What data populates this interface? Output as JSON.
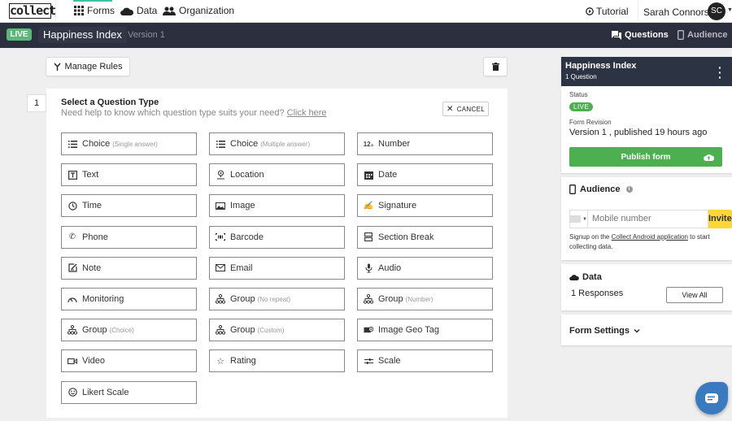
{
  "topnav": {
    "logo": "collect",
    "items": [
      {
        "label": "Forms",
        "icon": "grid-icon"
      },
      {
        "label": "Data",
        "icon": "cloud-icon"
      },
      {
        "label": "Organization",
        "icon": "people-icon"
      }
    ],
    "tutorial": "Tutorial",
    "user_name": "Sarah Connors",
    "user_initials": "SC"
  },
  "formbar": {
    "status": "LIVE",
    "title": "Happiness Index",
    "version": "Version 1",
    "tabs": [
      {
        "label": "Questions",
        "active": true
      },
      {
        "label": "Audience",
        "active": false
      }
    ]
  },
  "toolbar": {
    "manage_rules": "Manage Rules"
  },
  "question": {
    "number": "1",
    "title": "Select a Question Type",
    "help_text": "Need help to know which question type suits your need?",
    "help_link": "Click here",
    "cancel": "CANCEL",
    "types": [
      {
        "label": "Choice",
        "sub": "(Single answer)",
        "icon": "list-icon"
      },
      {
        "label": "Choice",
        "sub": "(Multiple answer)",
        "icon": "list-icon"
      },
      {
        "label": "Number",
        "sub": "",
        "icon": "123"
      },
      {
        "label": "Text",
        "sub": "",
        "icon": "text-icon"
      },
      {
        "label": "Location",
        "sub": "",
        "icon": "location-icon"
      },
      {
        "label": "Date",
        "sub": "",
        "icon": "calendar-icon"
      },
      {
        "label": "Time",
        "sub": "",
        "icon": "clock-icon"
      },
      {
        "label": "Image",
        "sub": "",
        "icon": "image-icon"
      },
      {
        "label": "Signature",
        "sub": "",
        "icon": "signature-icon"
      },
      {
        "label": "Phone",
        "sub": "",
        "icon": "phone-icon"
      },
      {
        "label": "Barcode",
        "sub": "",
        "icon": "barcode-icon"
      },
      {
        "label": "Section Break",
        "sub": "",
        "icon": "section-icon"
      },
      {
        "label": "Note",
        "sub": "",
        "icon": "note-icon"
      },
      {
        "label": "Email",
        "sub": "",
        "icon": "email-icon"
      },
      {
        "label": "Audio",
        "sub": "",
        "icon": "mic-icon"
      },
      {
        "label": "Monitoring",
        "sub": "",
        "icon": "gauge-icon"
      },
      {
        "label": "Group",
        "sub": "(No repeat)",
        "icon": "group-icon"
      },
      {
        "label": "Group",
        "sub": "(Number)",
        "icon": "group-icon"
      },
      {
        "label": "Group",
        "sub": "(Choice)",
        "icon": "group-icon"
      },
      {
        "label": "Group",
        "sub": "(Custom)",
        "icon": "group-icon"
      },
      {
        "label": "Image Geo Tag",
        "sub": "",
        "icon": "geotag-icon"
      },
      {
        "label": "Video",
        "sub": "",
        "icon": "video-icon"
      },
      {
        "label": "Rating",
        "sub": "",
        "icon": "star-icon"
      },
      {
        "label": "Scale",
        "sub": "",
        "icon": "sliders-icon"
      },
      {
        "label": "Likert Scale",
        "sub": "",
        "icon": "smiley-icon"
      }
    ]
  },
  "sidebar": {
    "form": {
      "title": "Happiness Index",
      "question_count": "1 Question",
      "status_label": "Status",
      "status": "LIVE",
      "revision_label": "Form Revision",
      "revision": "Version 1 , published 19 hours ago",
      "publish": "Publish form"
    },
    "audience": {
      "title": "Audience",
      "mobile_placeholder": "Mobile number",
      "invite": "Invite",
      "note_prefix": "Signup on the ",
      "note_link": "Collect Android application",
      "note_suffix": " to start collecting data."
    },
    "data": {
      "title": "Data",
      "responses": "1 Responses",
      "view_all": "View All"
    },
    "settings": {
      "title": "Form Settings"
    }
  },
  "colors": {
    "accent_green": "#4caf50",
    "live_badge": "#5cb87a",
    "header_dark": "#2c2f3e",
    "invite_yellow": "#fdd835",
    "chat_blue": "#3a7abf",
    "forms_indicator": "#3ec2a6"
  }
}
